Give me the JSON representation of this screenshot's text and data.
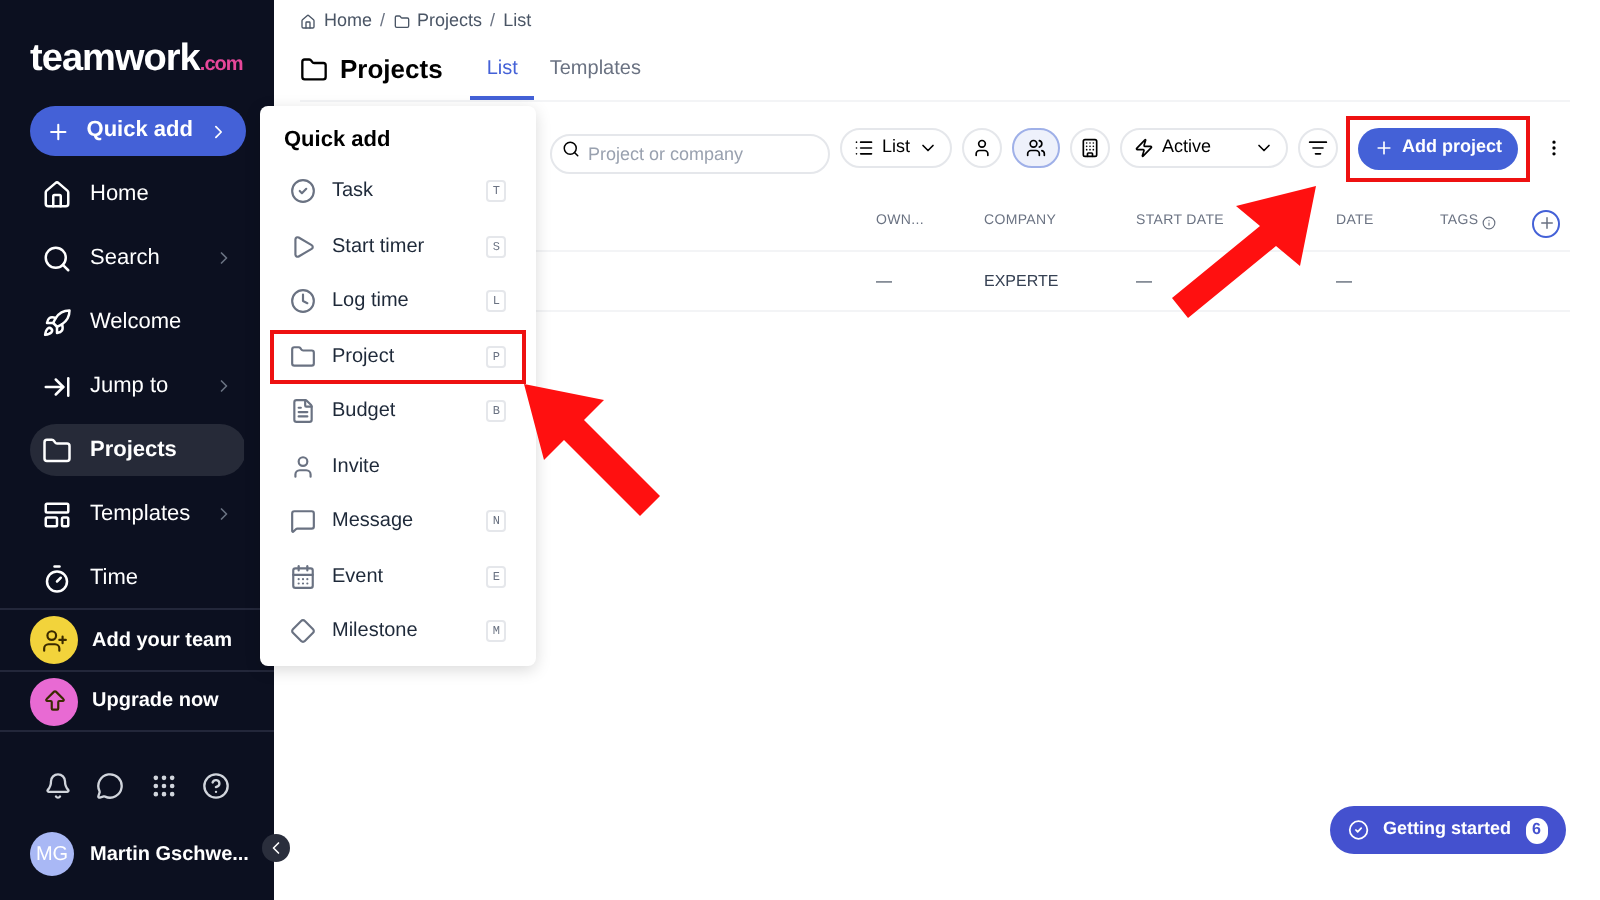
{
  "sidebar": {
    "logo": "teamwork",
    "logo_suffix": ".com",
    "quick_add": "Quick add",
    "items": [
      {
        "label": "Home",
        "chevron": false,
        "selected": false
      },
      {
        "label": "Search",
        "chevron": true,
        "selected": false
      },
      {
        "label": "Welcome",
        "chevron": false,
        "selected": false
      },
      {
        "label": "Jump to",
        "chevron": true,
        "selected": false
      },
      {
        "label": "Projects",
        "chevron": false,
        "selected": true
      },
      {
        "label": "Templates",
        "chevron": true,
        "selected": false
      },
      {
        "label": "Time",
        "chevron": false,
        "selected": false
      }
    ],
    "promos": [
      {
        "label": "Add your team",
        "color": "#f2d33b"
      },
      {
        "label": "Upgrade now",
        "color": "#e86ad3"
      }
    ],
    "user": {
      "initials": "MG",
      "name": "Martin Gschwe..."
    }
  },
  "breadcrumb": [
    {
      "kind": "link",
      "text": "Home"
    },
    {
      "kind": "separator",
      "text": "/"
    },
    {
      "kind": "link",
      "text": "Projects"
    },
    {
      "kind": "separator",
      "text": "/"
    },
    {
      "kind": "link",
      "text": "List"
    }
  ],
  "header": {
    "title": "Projects",
    "tabs": [
      {
        "label": "List",
        "selected": true
      },
      {
        "label": "Templates",
        "selected": false
      }
    ]
  },
  "toolbar": {
    "search": {
      "placeholder": "Project or company"
    },
    "view": "List",
    "status": "Active",
    "add_button": "Add project",
    "add_button_highlighted": true
  },
  "table": {
    "columns": [
      "OWN...",
      "COMPANY",
      "START DATE",
      "DATE",
      "TAGS"
    ],
    "rows": [
      [
        "—",
        "EXPERTE",
        "—",
        "—",
        ""
      ]
    ]
  },
  "quick_add_menu": {
    "title": "Quick add",
    "items": [
      {
        "label": "Task",
        "shortcut": "T",
        "highlighted": false
      },
      {
        "label": "Start timer",
        "shortcut": "S",
        "highlighted": false
      },
      {
        "label": "Log time",
        "shortcut": "L",
        "highlighted": false
      },
      {
        "label": "Project",
        "shortcut": "P",
        "highlighted": true
      },
      {
        "label": "Budget",
        "shortcut": "B",
        "highlighted": false
      },
      {
        "label": "Invite",
        "highlighted": false
      },
      {
        "label": "Message",
        "shortcut": "N",
        "highlighted": false
      },
      {
        "label": "Event",
        "shortcut": "E",
        "highlighted": false
      },
      {
        "label": "Milestone",
        "shortcut": "M",
        "highlighted": false
      }
    ]
  },
  "getting_started": {
    "label": "Getting started",
    "count": "6"
  }
}
